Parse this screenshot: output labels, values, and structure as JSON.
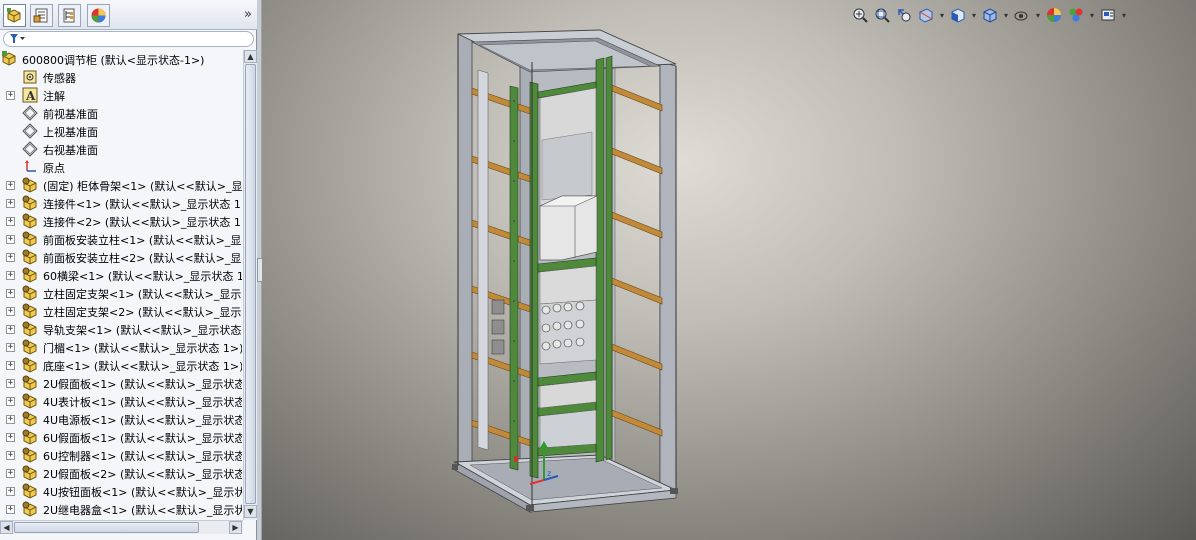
{
  "panel": {
    "tabs": [
      {
        "icon": "feature-manager-tree-icon"
      },
      {
        "icon": "property-manager-icon"
      },
      {
        "icon": "configuration-manager-icon"
      },
      {
        "icon": "display-manager-icon"
      }
    ],
    "expand_label": "»",
    "filter_icon": "filter-icon"
  },
  "tree": {
    "root": {
      "label": "600800调节柜  (默认<显示状态-1>)",
      "icon": "assembly-icon"
    },
    "items": [
      {
        "label": "传感器",
        "icon": "sensors-icon",
        "expander": false
      },
      {
        "label": "注解",
        "icon": "annotations-icon",
        "expander": true
      },
      {
        "label": "前视基准面",
        "icon": "plane-icon",
        "expander": false
      },
      {
        "label": "上视基准面",
        "icon": "plane-icon",
        "expander": false
      },
      {
        "label": "右视基准面",
        "icon": "plane-icon",
        "expander": false
      },
      {
        "label": "原点",
        "icon": "origin-icon",
        "expander": false
      },
      {
        "label": "(固定) 柜体骨架<1> (默认<<默认>_显",
        "icon": "part-icon",
        "expander": true
      },
      {
        "label": "连接件<1> (默认<<默认>_显示状态 1",
        "icon": "part-icon",
        "expander": true
      },
      {
        "label": "连接件<2> (默认<<默认>_显示状态 1",
        "icon": "part-icon",
        "expander": true
      },
      {
        "label": "前面板安装立柱<1> (默认<<默认>_显",
        "icon": "part-icon",
        "expander": true
      },
      {
        "label": "前面板安装立柱<2> (默认<<默认>_显",
        "icon": "part-icon",
        "expander": true
      },
      {
        "label": "60横梁<1> (默认<<默认>_显示状态 1",
        "icon": "part-icon",
        "expander": true
      },
      {
        "label": "立柱固定支架<1> (默认<<默认>_显示",
        "icon": "part-icon",
        "expander": true
      },
      {
        "label": "立柱固定支架<2> (默认<<默认>_显示",
        "icon": "part-icon",
        "expander": true
      },
      {
        "label": "导轨支架<1> (默认<<默认>_显示状态",
        "icon": "part-icon",
        "expander": true
      },
      {
        "label": "门楣<1> (默认<<默认>_显示状态 1>)",
        "icon": "part-icon",
        "expander": true
      },
      {
        "label": "底座<1> (默认<<默认>_显示状态 1>)",
        "icon": "part-icon",
        "expander": true
      },
      {
        "label": "2U假面板<1> (默认<<默认>_显示状态",
        "icon": "part-icon",
        "expander": true
      },
      {
        "label": "4U表计板<1> (默认<<默认>_显示状态",
        "icon": "part-icon",
        "expander": true
      },
      {
        "label": "4U电源板<1> (默认<<默认>_显示状态",
        "icon": "part-icon",
        "expander": true
      },
      {
        "label": "6U假面板<1> (默认<<默认>_显示状态",
        "icon": "part-icon",
        "expander": true
      },
      {
        "label": "6U控制器<1> (默认<<默认>_显示状态",
        "icon": "part-icon",
        "expander": true
      },
      {
        "label": "2U假面板<2> (默认<<默认>_显示状态",
        "icon": "part-icon",
        "expander": true
      },
      {
        "label": "4U按钮面板<1> (默认<<默认>_显示状",
        "icon": "part-icon",
        "expander": true
      },
      {
        "label": "2U继电器盒<1> (默认<<默认>_显示状",
        "icon": "part-icon",
        "expander": true
      }
    ]
  },
  "headsup": [
    {
      "icon": "zoom-to-fit-icon"
    },
    {
      "icon": "zoom-to-area-icon"
    },
    {
      "icon": "previous-view-icon"
    },
    {
      "icon": "section-view-icon"
    },
    {
      "icon": "view-orientation-icon",
      "dropdown": true
    },
    {
      "icon": "display-style-icon",
      "dropdown": true
    },
    {
      "icon": "hide-show-items-icon",
      "dropdown": true
    },
    {
      "icon": "edit-appearance-icon"
    },
    {
      "icon": "apply-scene-icon",
      "dropdown": true
    },
    {
      "icon": "view-settings-icon",
      "dropdown": true
    }
  ],
  "colors": {
    "frame": "#8c94a6",
    "rail_green": "#4f8a3c",
    "bracket_orange": "#c08a3a",
    "panel_gray": "#d8d8d8"
  }
}
